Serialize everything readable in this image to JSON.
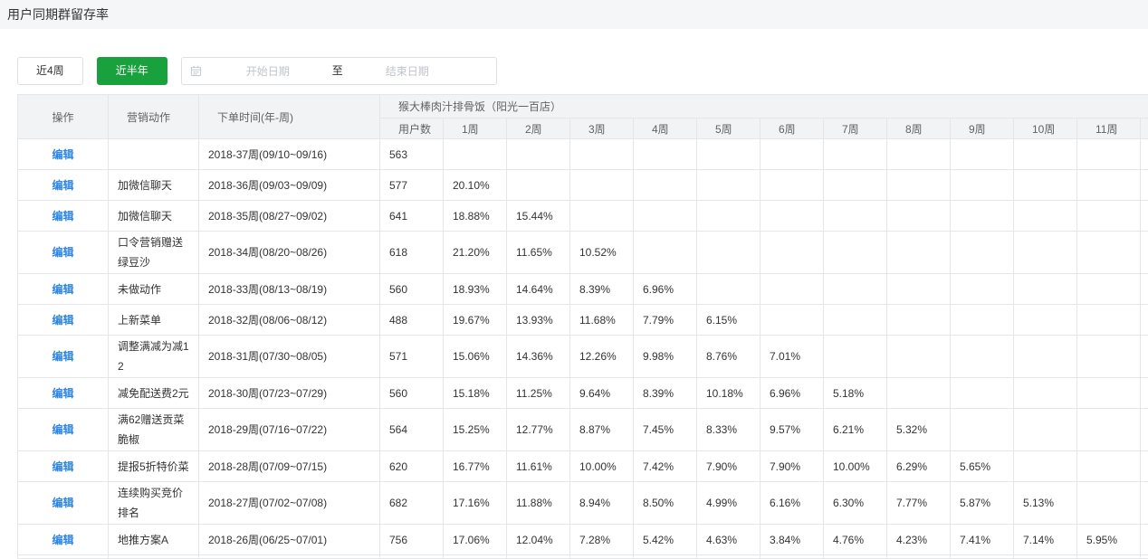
{
  "page": {
    "title": "用户同期群留存率"
  },
  "filters": {
    "range_buttons": [
      {
        "label": "近4周",
        "active": false
      },
      {
        "label": "近半年",
        "active": true
      }
    ],
    "date_range": {
      "icon": "calendar-icon",
      "start_placeholder": "开始日期",
      "separator": "至",
      "end_placeholder": "结束日期"
    }
  },
  "colors": {
    "accent_green": "#19a13d",
    "link_blue": "#2b85e4"
  },
  "table": {
    "headers": {
      "action": "操作",
      "campaign": "营销动作",
      "order_week": "下单时间(年-周)",
      "store": "猴大棒肉汁排骨饭（阳光一百店）"
    },
    "sub_columns": [
      "用户数",
      "1周",
      "2周",
      "3周",
      "4周",
      "5周",
      "6周",
      "7周",
      "8周",
      "9周",
      "10周",
      "11周"
    ],
    "rows": [
      {
        "action": "编辑",
        "campaign": "",
        "order_week": "2018-37周(09/10~09/16)",
        "users": 563,
        "retention": []
      },
      {
        "action": "编辑",
        "campaign": "加微信聊天",
        "order_week": "2018-36周(09/03~09/09)",
        "users": 577,
        "retention": [
          "20.10%"
        ]
      },
      {
        "action": "编辑",
        "campaign": "加微信聊天",
        "order_week": "2018-35周(08/27~09/02)",
        "users": 641,
        "retention": [
          "18.88%",
          "15.44%"
        ]
      },
      {
        "action": "编辑",
        "campaign": "口令营销赠送绿豆沙",
        "order_week": "2018-34周(08/20~08/26)",
        "users": 618,
        "retention": [
          "21.20%",
          "11.65%",
          "10.52%"
        ]
      },
      {
        "action": "编辑",
        "campaign": "未做动作",
        "order_week": "2018-33周(08/13~08/19)",
        "users": 560,
        "retention": [
          "18.93%",
          "14.64%",
          "8.39%",
          "6.96%"
        ]
      },
      {
        "action": "编辑",
        "campaign": "上新菜单",
        "order_week": "2018-32周(08/06~08/12)",
        "users": 488,
        "retention": [
          "19.67%",
          "13.93%",
          "11.68%",
          "7.79%",
          "6.15%"
        ]
      },
      {
        "action": "编辑",
        "campaign": "调整满减为减12",
        "order_week": "2018-31周(07/30~08/05)",
        "users": 571,
        "retention": [
          "15.06%",
          "14.36%",
          "12.26%",
          "9.98%",
          "8.76%",
          "7.01%"
        ]
      },
      {
        "action": "编辑",
        "campaign": "减免配送费2元",
        "order_week": "2018-30周(07/23~07/29)",
        "users": 560,
        "retention": [
          "15.18%",
          "11.25%",
          "9.64%",
          "8.39%",
          "10.18%",
          "6.96%",
          "5.18%"
        ]
      },
      {
        "action": "编辑",
        "campaign": "满62赠送贡菜脆椒",
        "order_week": "2018-29周(07/16~07/22)",
        "users": 564,
        "retention": [
          "15.25%",
          "12.77%",
          "8.87%",
          "7.45%",
          "8.33%",
          "9.57%",
          "6.21%",
          "5.32%"
        ]
      },
      {
        "action": "编辑",
        "campaign": "提报5折特价菜",
        "order_week": "2018-28周(07/09~07/15)",
        "users": 620,
        "retention": [
          "16.77%",
          "11.61%",
          "10.00%",
          "7.42%",
          "7.90%",
          "7.90%",
          "10.00%",
          "6.29%",
          "5.65%"
        ]
      },
      {
        "action": "编辑",
        "campaign": "连续购买竞价排名",
        "order_week": "2018-27周(07/02~07/08)",
        "users": 682,
        "retention": [
          "17.16%",
          "11.88%",
          "8.94%",
          "8.50%",
          "4.99%",
          "6.16%",
          "6.30%",
          "7.77%",
          "5.87%",
          "5.13%"
        ]
      },
      {
        "action": "编辑",
        "campaign": "地推方案A",
        "order_week": "2018-26周(06/25~07/01)",
        "users": 756,
        "retention": [
          "17.06%",
          "12.04%",
          "7.28%",
          "5.42%",
          "4.63%",
          "3.84%",
          "4.76%",
          "4.23%",
          "7.41%",
          "7.14%",
          "5.95%"
        ]
      }
    ]
  }
}
